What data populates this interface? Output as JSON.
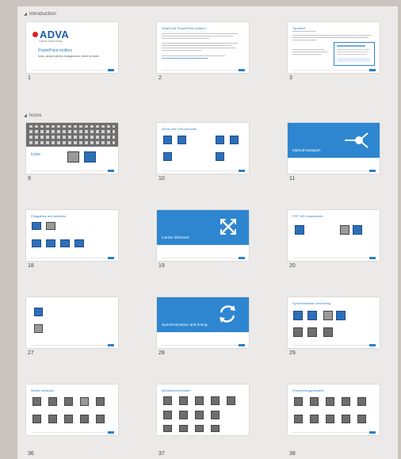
{
  "sections": [
    {
      "label": "Introduction"
    },
    {
      "label": "Icons"
    }
  ],
  "slides": [
    {
      "num": "1",
      "brand": "ADVA",
      "brand_sub": "Optical Networking",
      "title": "PowerPoint toolbox",
      "subtitle": "Icons, product photos, backgrounds, choice of colors"
    },
    {
      "num": "2",
      "title": "What's the PowerPoint toolbox?"
    },
    {
      "num": "3",
      "title": "Typeface"
    },
    {
      "num": "9",
      "title": "Icons"
    },
    {
      "num": "10",
      "title": "ADVA and OSA products"
    },
    {
      "num": "11",
      "title": "Optical transport"
    },
    {
      "num": "18",
      "title": "Pluggables and switches"
    },
    {
      "num": "19",
      "title": "Carrier Ethernet"
    },
    {
      "num": "20",
      "title": "FSP 150 components"
    },
    {
      "num": "27",
      "title": ""
    },
    {
      "num": "28",
      "title": "Synchronization and timing"
    },
    {
      "num": "29",
      "title": "Synchronization and timing"
    },
    {
      "num": "36",
      "title": "Mobile networks"
    },
    {
      "num": "37",
      "title": "Media/Internet/cable"
    },
    {
      "num": "38",
      "title": "Power/energy/weather"
    }
  ],
  "colors": {
    "accent": "#2e86d0",
    "pane": "#eceae8",
    "desktop": "#c9c4bd"
  }
}
